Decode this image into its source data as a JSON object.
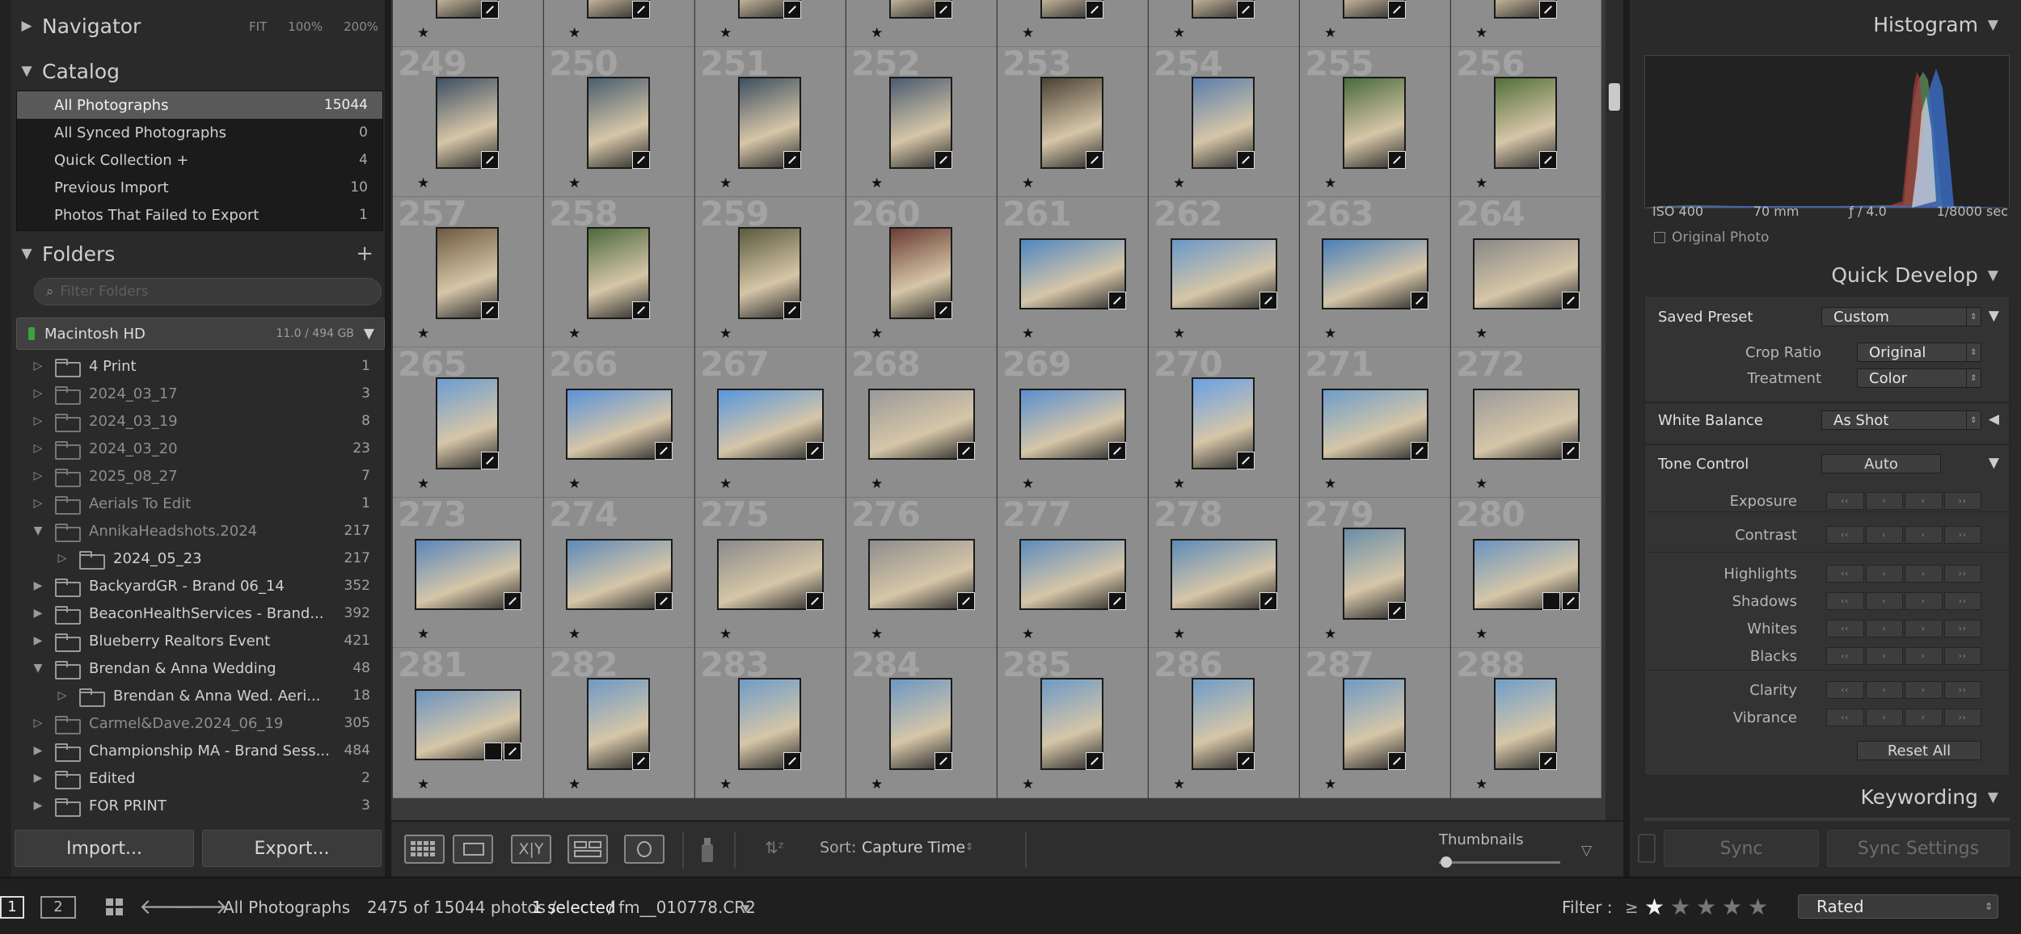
{
  "navigator": {
    "title": "Navigator",
    "opts": [
      "FIT",
      "100%",
      "200%"
    ]
  },
  "catalog": {
    "title": "Catalog",
    "items": [
      {
        "label": "All Photographs",
        "count": "15044"
      },
      {
        "label": "All Synced Photographs",
        "count": "0"
      },
      {
        "label": "Quick Collection  +",
        "count": "4"
      },
      {
        "label": "Previous Import",
        "count": "10"
      },
      {
        "label": "Photos That Failed to Export",
        "count": "1"
      }
    ]
  },
  "folders": {
    "title": "Folders",
    "add": "+",
    "filter_placeholder": "Filter Folders",
    "volume": {
      "name": "Macintosh HD",
      "size": "11.0 / 494 GB"
    },
    "items": [
      {
        "label": "4 Print",
        "count": "1"
      },
      {
        "label": "2024_03_17",
        "count": "3"
      },
      {
        "label": "2024_03_19",
        "count": "8"
      },
      {
        "label": "2024_03_20",
        "count": "23"
      },
      {
        "label": "2025_08_27",
        "count": "7"
      },
      {
        "label": "Aerials To Edit",
        "count": "1"
      },
      {
        "label": "AnnikaHeadshots.2024",
        "count": "217"
      },
      {
        "label": "2024_05_23",
        "count": "217"
      },
      {
        "label": "BackyardGR - Brand 06_14",
        "count": "352"
      },
      {
        "label": "BeaconHealthServices - Brand...",
        "count": "392"
      },
      {
        "label": "Blueberry Realtors Event",
        "count": "421"
      },
      {
        "label": "Brendan & Anna Wedding",
        "count": "48"
      },
      {
        "label": "Brendan & Anna Wed. Aeri...",
        "count": "18"
      },
      {
        "label": "Carmel&Dave.2024_06_19",
        "count": "305"
      },
      {
        "label": "Championship MA - Brand Sess...",
        "count": "484"
      },
      {
        "label": "Edited",
        "count": "2"
      },
      {
        "label": "FOR PRINT",
        "count": "3"
      }
    ]
  },
  "buttons": {
    "import": "Import...",
    "export": "Export..."
  },
  "grid": {
    "rows": [
      {
        "nums": [
          "",
          "",
          "",
          "",
          "",
          "",
          "",
          ""
        ]
      },
      {
        "nums": [
          "249",
          "250",
          "251",
          "252",
          "253",
          "254",
          "255",
          "256"
        ]
      },
      {
        "nums": [
          "257",
          "258",
          "259",
          "260",
          "261",
          "262",
          "263",
          "264"
        ]
      },
      {
        "nums": [
          "265",
          "266",
          "267",
          "268",
          "269",
          "270",
          "271",
          "272"
        ]
      },
      {
        "nums": [
          "273",
          "274",
          "275",
          "276",
          "277",
          "278",
          "279",
          "280"
        ]
      },
      {
        "nums": [
          "281",
          "282",
          "283",
          "284",
          "285",
          "286",
          "287",
          "288"
        ]
      }
    ]
  },
  "toolbar": {
    "sort_label": "Sort:",
    "sort_value": "Capture Time",
    "thumbnails_label": "Thumbnails"
  },
  "histogram": {
    "title": "Histogram",
    "iso": "ISO 400",
    "focal": "70 mm",
    "aperture": "ƒ / 4.0",
    "shutter": "1/8000 sec",
    "original_photo": "Original Photo"
  },
  "quick_develop": {
    "title": "Quick Develop",
    "saved_preset_label": "Saved Preset",
    "saved_preset_value": "Custom",
    "crop_ratio_label": "Crop Ratio",
    "crop_ratio_value": "Original",
    "treatment_label": "Treatment",
    "treatment_value": "Color",
    "white_balance_label": "White Balance",
    "white_balance_value": "As Shot",
    "tone_control_label": "Tone Control",
    "auto": "Auto",
    "tone_items": [
      "Exposure",
      "Contrast",
      "Highlights",
      "Shadows",
      "Whites",
      "Blacks",
      "Clarity",
      "Vibrance"
    ],
    "reset_all": "Reset All"
  },
  "keywording": {
    "title": "Keywording"
  },
  "sync": {
    "sync": "Sync",
    "sync_settings": "Sync Settings"
  },
  "statusbar": {
    "view1": "1",
    "view2": "2",
    "source": "All Photographs",
    "count": "2475 of 15044 photos /",
    "selected": "1 selected",
    "file": "/ fm__010778.CR2",
    "filter_label": "Filter :",
    "filter_op": "≥",
    "filter_value": "Rated"
  },
  "colors": {
    "accent_selected": "#595959",
    "grid_cell": "#8d8d8d",
    "volume_led": "#3ca23c"
  }
}
